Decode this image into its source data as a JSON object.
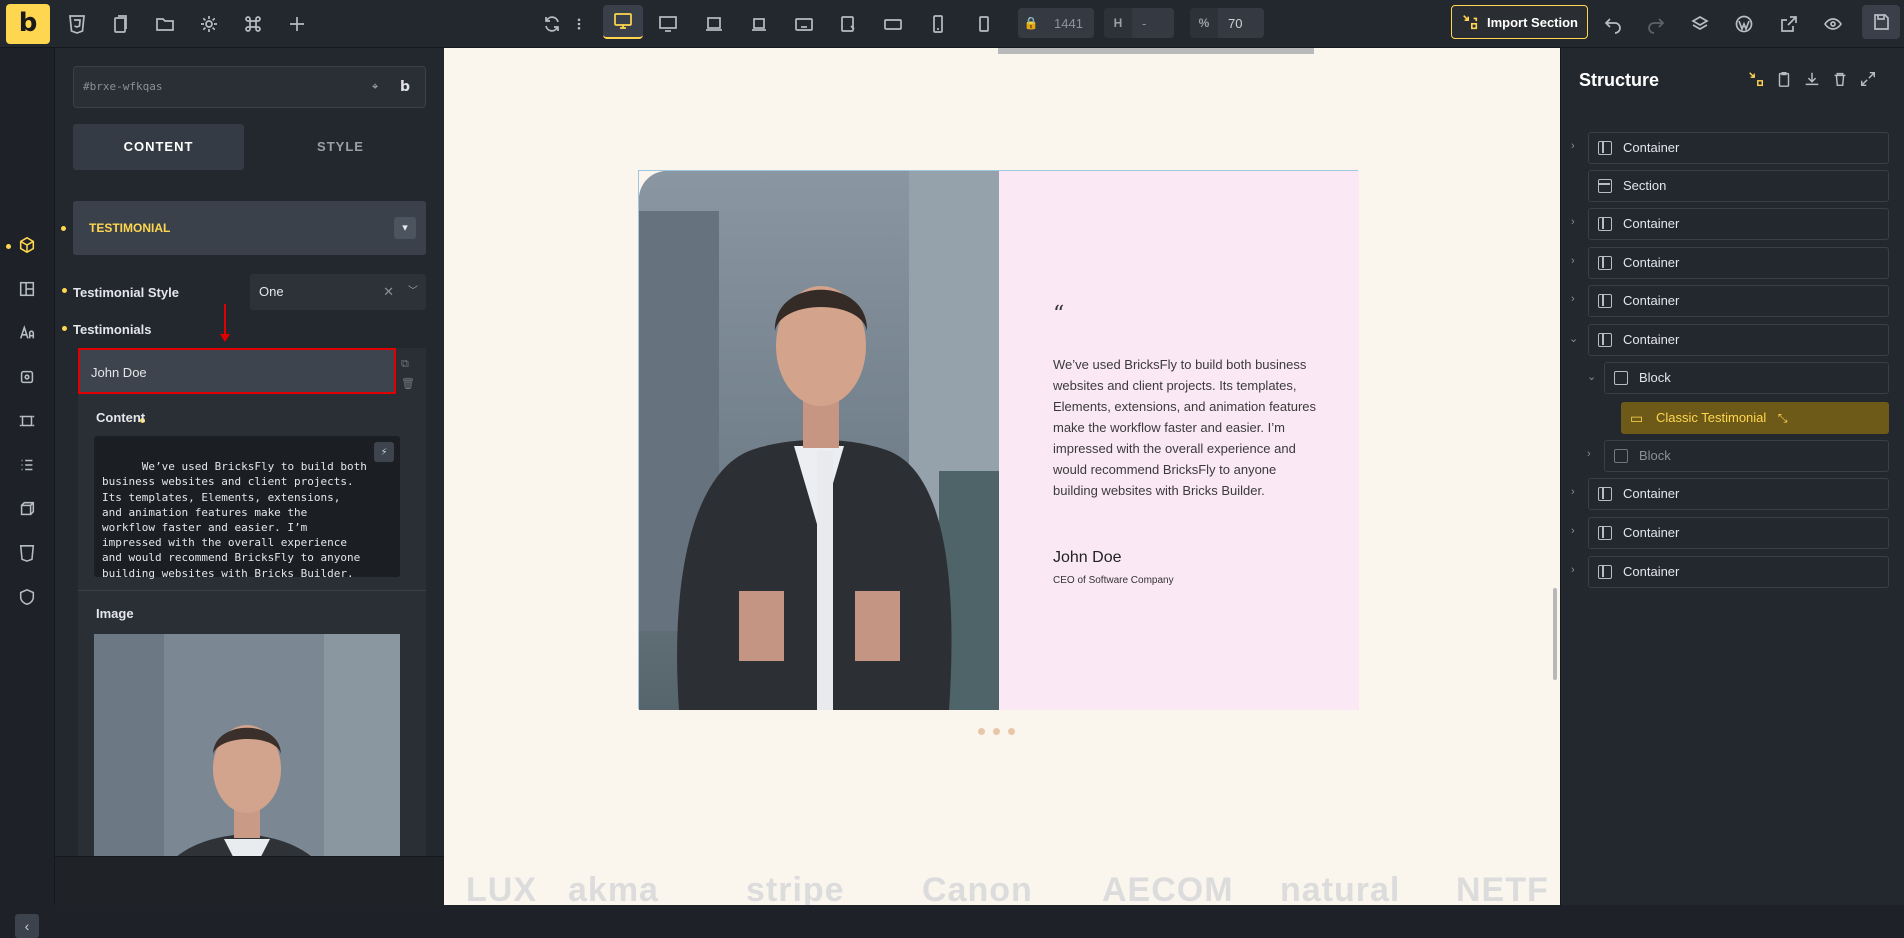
{
  "topbar": {
    "logo_letter": "b",
    "width_label": "1441",
    "height_key": "H",
    "height_value": "-",
    "zoom_key": "%",
    "zoom_value": "70",
    "import_label": "Import Section"
  },
  "panel": {
    "element_id": "#brxe-wfkqas",
    "tab_content": "CONTENT",
    "tab_style": "STYLE",
    "group_title": "TESTIMONIAL",
    "style_label": "Testimonial Style",
    "style_value": "One",
    "testimonials_label": "Testimonials",
    "item_name": "John Doe",
    "content_label": "Content",
    "content_text": "We’ve used BricksFly to build both\nbusiness websites and client projects.\nIts templates, Elements, extensions,\nand animation features make the\nworkflow faster and easier. I’m\nimpressed with the overall experience\nand would recommend BricksFly to anyone\nbuilding websites with Bricks Builder.",
    "image_label": "Image"
  },
  "canvas": {
    "quote": "“",
    "testimonial_text": "We’ve used BricksFly to build both business websites and client projects. Its templates, Elements, extensions, and animation features make the workflow faster and easier. I’m impressed with the overall experience and would recommend BricksFly to anyone building websites with Bricks Builder.",
    "author_name": "John Doe",
    "author_role": "CEO of Software Company",
    "logos": [
      "LUX",
      "akma",
      "stripe",
      "Canon",
      "AECOM",
      "natural",
      "NETF"
    ]
  },
  "structure": {
    "title": "Structure",
    "items": [
      {
        "label": "Container"
      },
      {
        "label": "Section"
      },
      {
        "label": "Container"
      },
      {
        "label": "Container"
      },
      {
        "label": "Container"
      },
      {
        "label": "Container"
      },
      {
        "label": "Block"
      },
      {
        "label": "Classic Testimonial"
      },
      {
        "label": "Block"
      },
      {
        "label": "Container"
      },
      {
        "label": "Container"
      },
      {
        "label": "Container"
      }
    ]
  },
  "colors": {
    "accent": "#ffd64f",
    "highlight_border": "#e00000",
    "canvas_bg": "#faf6ee",
    "card_bg": "#fae8f4"
  }
}
